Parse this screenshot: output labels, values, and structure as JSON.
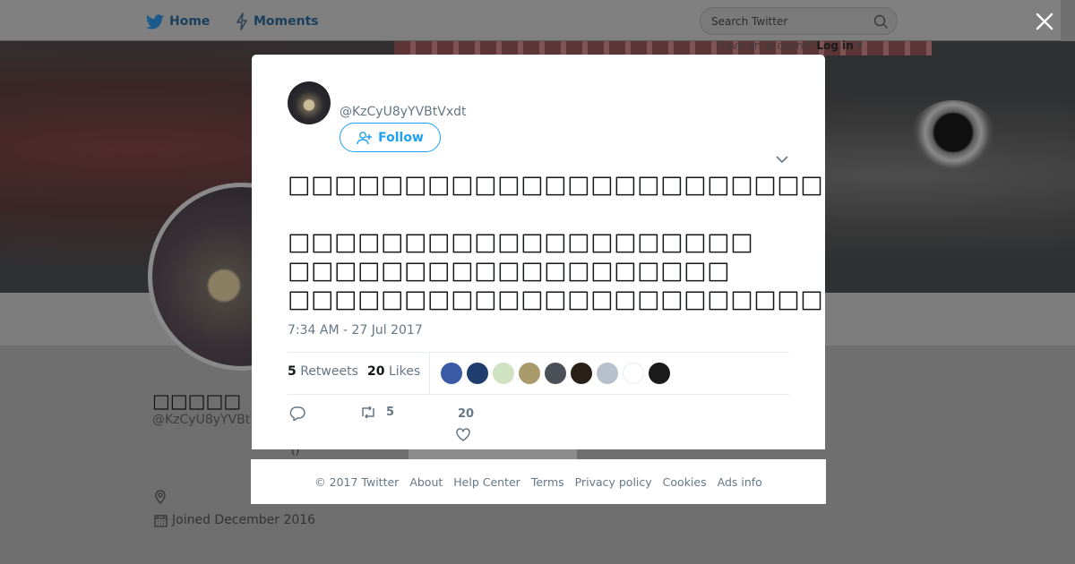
{
  "nav": {
    "home_label": "Home",
    "moments_label": "Moments",
    "search_placeholder": "Search Twitter",
    "login_prompt": "Have an account?",
    "login_label": "Log in"
  },
  "profile": {
    "name": "□□□□□",
    "handle": "@KzCyU8yYVBtVxdt",
    "joined": "Joined December 2016",
    "paren": "()"
  },
  "tweet": {
    "author_handle": "@KzCyU8yYVBtVxdt",
    "follow_label": "Follow",
    "text": "□□□□□□□□□□□□□□□□□□□□□□□□□□□□□□□□□□□□□□□□□□\n\n□□□□□□□□□□□□□□□□□□□□\n□□□□□□□□□□□□□□□□□□□\n□□□□□□□□□□□□□□□□□□□□□□□□□□□□□□□□□□□□□",
    "timestamp": "7:34 AM - 27 Jul 2017",
    "retweets_count": "5",
    "retweets_label": "Retweets",
    "likes_count": "20",
    "likes_label": "Likes",
    "action_retweet_count": "5",
    "action_like_count": "20"
  },
  "likers": [
    {
      "name": "liker-1",
      "color": "#3a5aa8"
    },
    {
      "name": "liker-2",
      "color": "#1f3d6e"
    },
    {
      "name": "liker-3",
      "color": "#cfe3c2"
    },
    {
      "name": "liker-4",
      "color": "#a89a6a"
    },
    {
      "name": "liker-5",
      "color": "#4a4f58"
    },
    {
      "name": "liker-6",
      "color": "#2a2018"
    },
    {
      "name": "liker-7",
      "color": "#b8c0cc"
    },
    {
      "name": "liker-8",
      "color": "#ffffff"
    },
    {
      "name": "liker-9",
      "color": "#1a1a1a"
    }
  ],
  "footer": {
    "copyright": "© 2017 Twitter",
    "links": [
      "About",
      "Help Center",
      "Terms",
      "Privacy policy",
      "Cookies",
      "Ads info"
    ]
  },
  "colors": {
    "accent": "#1da1f2",
    "muted": "#657786"
  }
}
